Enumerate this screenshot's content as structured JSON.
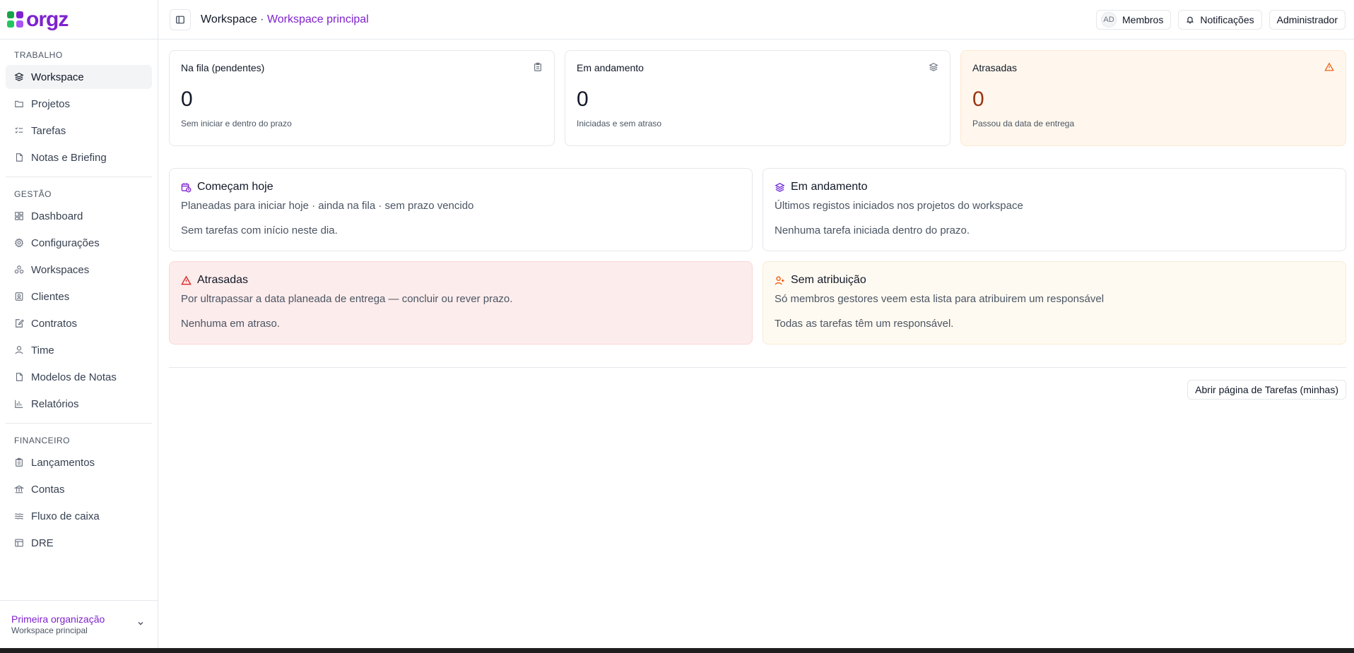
{
  "app": {
    "logo_text": "orgz",
    "logo_colors": [
      "#16a34a",
      "#7e22ce",
      "#22c55e",
      "#a855f7"
    ]
  },
  "sidebar": {
    "sections": [
      {
        "label": "TRABALHO",
        "items": [
          {
            "label": "Workspace",
            "icon": "layers-icon",
            "active": true
          },
          {
            "label": "Projetos",
            "icon": "folder-icon"
          },
          {
            "label": "Tarefas",
            "icon": "list-check-icon"
          },
          {
            "label": "Notas e Briefing",
            "icon": "file-icon"
          }
        ]
      },
      {
        "label": "GESTÃO",
        "items": [
          {
            "label": "Dashboard",
            "icon": "grid-icon"
          },
          {
            "label": "Configurações",
            "icon": "gear-icon"
          },
          {
            "label": "Workspaces",
            "icon": "workspaces-icon"
          },
          {
            "label": "Clientes",
            "icon": "contact-icon"
          },
          {
            "label": "Contratos",
            "icon": "edit-doc-icon"
          },
          {
            "label": "Time",
            "icon": "user-icon"
          },
          {
            "label": "Modelos de Notas",
            "icon": "file-icon"
          },
          {
            "label": "Relatórios",
            "icon": "bar-chart-icon"
          }
        ]
      },
      {
        "label": "FINANCEIRO",
        "items": [
          {
            "label": "Lançamentos",
            "icon": "clipboard-icon"
          },
          {
            "label": "Contas",
            "icon": "bank-icon"
          },
          {
            "label": "Fluxo de caixa",
            "icon": "waves-icon"
          },
          {
            "label": "DRE",
            "icon": "table-icon"
          }
        ]
      }
    ],
    "org": {
      "name": "Primeira organização",
      "workspace": "Workspace principal"
    }
  },
  "header": {
    "crumb_root": "Workspace",
    "crumb_sep": " · ",
    "crumb_current": "Workspace principal",
    "avatar_initials": "AD",
    "members_label": "Membros",
    "notifications_label": "Notificações",
    "admin_label": "Administrador"
  },
  "stats": [
    {
      "title": "Na fila (pendentes)",
      "value": "0",
      "sub": "Sem iniciar e dentro do prazo",
      "icon": "clipboard-icon"
    },
    {
      "title": "Em andamento",
      "value": "0",
      "sub": "Iniciadas e sem atraso",
      "icon": "layers-icon"
    },
    {
      "title": "Atrasadas",
      "value": "0",
      "sub": "Passou da data de entrega",
      "icon": "warning-icon"
    }
  ],
  "panels": [
    {
      "title": "Começam hoje",
      "desc": "Planeadas para iniciar hoje · ainda na fila · sem prazo vencido",
      "empty": "Sem tarefas com início neste dia.",
      "icon": "calendar-clock-icon",
      "icon_color": "#7e22ce"
    },
    {
      "title": "Em andamento",
      "desc": "Últimos registos iniciados nos projetos do workspace",
      "empty": "Nenhuma tarefa iniciada dentro do prazo.",
      "icon": "layers-icon",
      "icon_color": "#6d28d9"
    },
    {
      "title": "Atrasadas",
      "desc": "Por ultrapassar a data planeada de entrega — concluir ou rever prazo.",
      "empty": "Nenhuma em atraso.",
      "icon": "warning-icon",
      "icon_color": "#dc2626"
    },
    {
      "title": "Sem atribuição",
      "desc": "Só membros gestores veem esta lista para atribuirem um responsável",
      "empty": "Todas as tarefas têm um responsável.",
      "icon": "user-plus-icon",
      "icon_color": "#ea580c"
    }
  ],
  "actions": {
    "open_tasks": "Abrir página de Tarefas (minhas)"
  }
}
